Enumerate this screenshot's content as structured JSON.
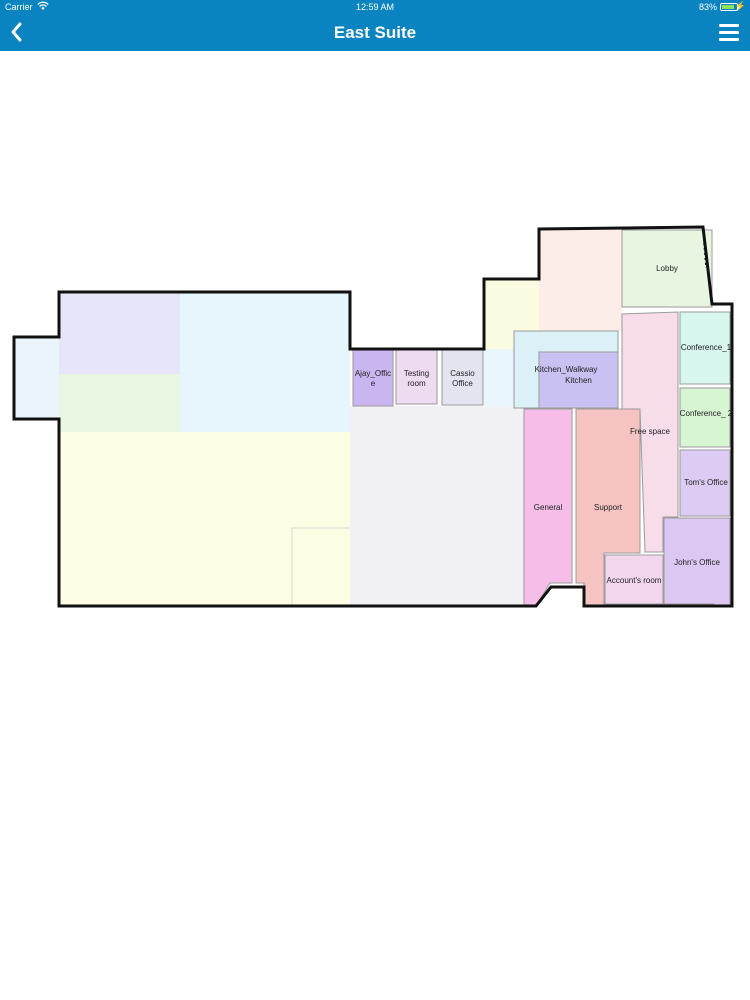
{
  "status_bar": {
    "carrier": "Carrier",
    "time": "12:59 AM",
    "battery_percent": "83%",
    "battery_level": 0.83
  },
  "nav": {
    "title": "East Suite",
    "back_icon": "chevron-left-icon",
    "menu_icon": "hamburger-menu-icon"
  },
  "rooms": {
    "lobby": "Lobby",
    "conference_1": "Conference_1",
    "ajay_office": "Ajay_Offic e",
    "testing_room": "Testing room",
    "cassio_office": "Cassio Office",
    "kitchen_walkway": "Kitchen_Walkway",
    "kitchen": "Kitchen",
    "conference_2": "Conference_ 2",
    "free_space": "Free space",
    "toms_office": "Tom's Office",
    "general": "General",
    "support": "Support",
    "johns_office": "John's Office",
    "accounts_room": "Account's room"
  },
  "colors": {
    "header": "#0a84c1",
    "outline": "#111111",
    "lobby": "#e8f5e1",
    "conference_1": "#d6f6ee",
    "conference_2": "#d7f5d3",
    "ajay_office": "#c9b6f1",
    "testing_room": "#eedaf1",
    "cassio_office": "#e3e4ef",
    "kitchen": "#c8c1f2",
    "general": "#f5bde8",
    "support": "#f5c4c2",
    "free_space": "#f7dde9",
    "toms_office": "#dcccf3",
    "johns_office": "#dcc7f3",
    "accounts_room": "#f2d6ee"
  }
}
